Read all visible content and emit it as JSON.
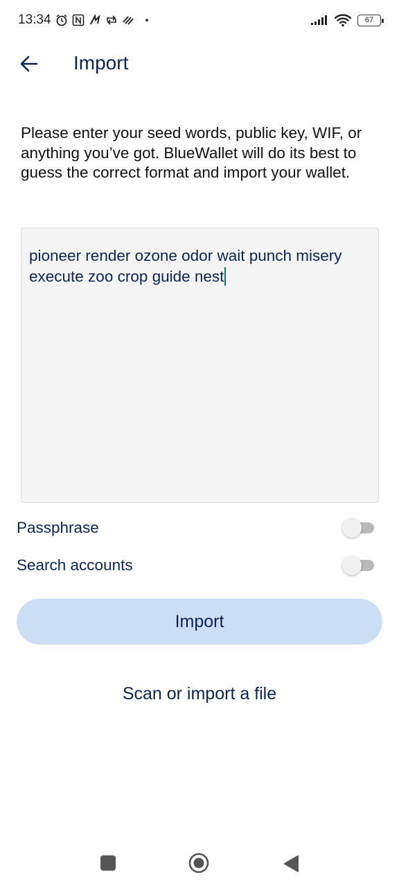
{
  "status_bar": {
    "time": "13:34",
    "battery": "67",
    "icons": [
      "alarm-icon",
      "nfc-icon",
      "data-icon",
      "sync-icon",
      "signal-icon",
      "wifi-icon",
      "battery-icon"
    ]
  },
  "header": {
    "title": "Import",
    "back_icon": "arrow-left-icon"
  },
  "description": "Please enter your seed words, public key, WIF, or anything you’ve got. BlueWallet will do its best to guess the correct format and import your wallet.",
  "seed_input": {
    "value": "pioneer render ozone odor wait punch misery execute zoo crop guide nest"
  },
  "options": [
    {
      "label": "Passphrase",
      "enabled": false
    },
    {
      "label": "Search accounts",
      "enabled": false
    }
  ],
  "import_button": {
    "label": "Import"
  },
  "scan_link": {
    "label": "Scan or import a file"
  },
  "colors": {
    "primary_text": "#0c2550",
    "button_bg": "#ccdef5",
    "input_bg": "#f4f4f4",
    "caret": "#0f7a60"
  }
}
